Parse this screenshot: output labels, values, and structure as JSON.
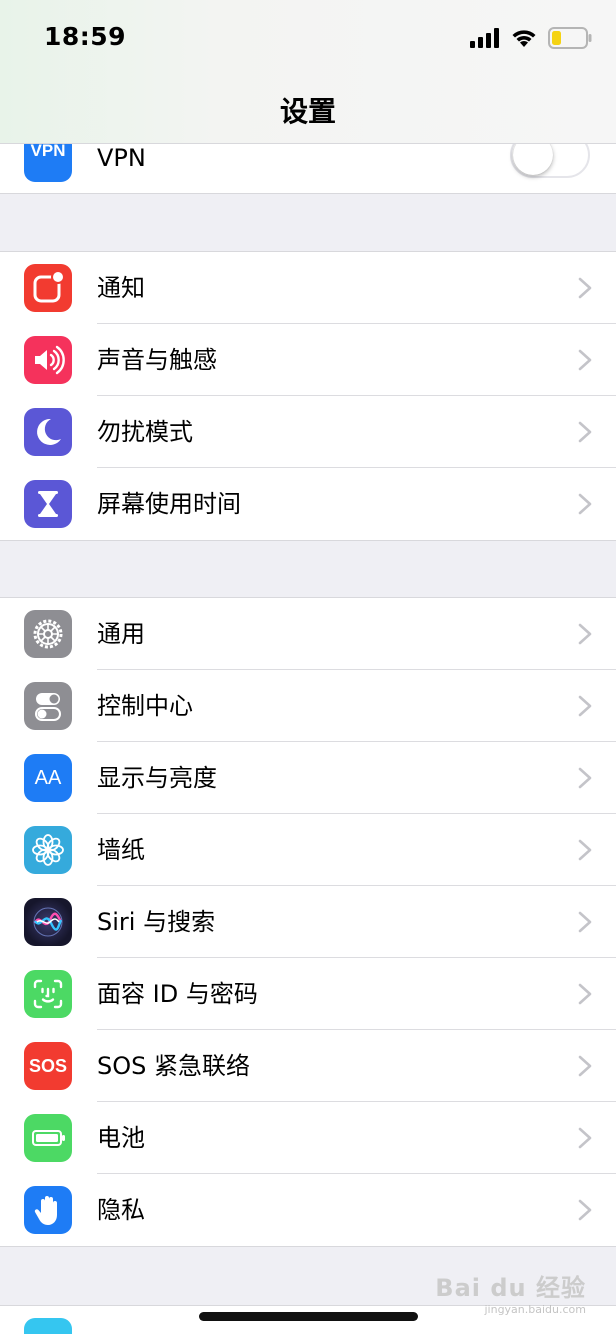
{
  "status_bar": {
    "time": "18:59",
    "icons": [
      "signal-icon",
      "wifi-icon",
      "battery-icon"
    ],
    "battery_color": "#f5d313"
  },
  "nav": {
    "title": "设置"
  },
  "vpn": {
    "icon_text": "VPN",
    "label": "VPN",
    "toggle_on": false,
    "icon_color": "#1e7cf5"
  },
  "group1": [
    {
      "label": "通知",
      "icon": "notifications-icon",
      "color": "#f23b30"
    },
    {
      "label": "声音与触感",
      "icon": "sound-icon",
      "color": "#f5325c"
    },
    {
      "label": "勿扰模式",
      "icon": "moon-icon",
      "color": "#5b57d6"
    },
    {
      "label": "屏幕使用时间",
      "icon": "hourglass-icon",
      "color": "#5b57d6"
    }
  ],
  "group2": [
    {
      "label": "通用",
      "icon": "gear-icon",
      "color": "#8e8e93"
    },
    {
      "label": "控制中心",
      "icon": "control-center-icon",
      "color": "#8e8e93"
    },
    {
      "label": "显示与亮度",
      "icon": "display-icon",
      "icon_text": "AA",
      "color": "#1e7cf5"
    },
    {
      "label": "墙纸",
      "icon": "wallpaper-icon",
      "color": "#35aadc"
    },
    {
      "label": "Siri 与搜索",
      "icon": "siri-icon",
      "color": "#1c1c3a"
    },
    {
      "label": "面容 ID 与密码",
      "icon": "face-id-icon",
      "color": "#4cd964"
    },
    {
      "label": "SOS 紧急联络",
      "icon": "sos-icon",
      "icon_text": "SOS",
      "color": "#f23b30"
    },
    {
      "label": "电池",
      "icon": "battery-settings-icon",
      "color": "#4cd964"
    },
    {
      "label": "隐私",
      "icon": "hand-icon",
      "color": "#1e7cf5"
    }
  ],
  "watermark": {
    "text": "Bai du 经验",
    "sub": "jingyan.baidu.com"
  }
}
